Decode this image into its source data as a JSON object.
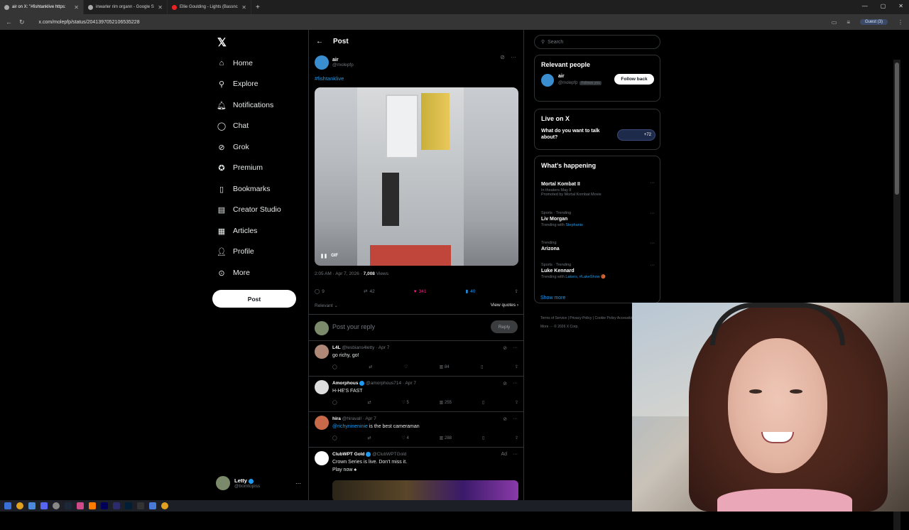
{
  "browser": {
    "tabs": [
      {
        "label": "air on X: \"#fishtanklive https:"
      },
      {
        "label": "inwarler rim organn - Google S"
      },
      {
        "label": "Ellie Goulding - Lights (Bassnc"
      }
    ],
    "url": "x.com/molepfp/status/2041397052106535228",
    "guest_label": "Guest (3)"
  },
  "nav": {
    "items": [
      {
        "label": "Home",
        "icon": "home-icon"
      },
      {
        "label": "Explore",
        "icon": "search-icon"
      },
      {
        "label": "Notifications",
        "icon": "bell-icon"
      },
      {
        "label": "Chat",
        "icon": "chat-icon"
      },
      {
        "label": "Grok",
        "icon": "grok-icon"
      },
      {
        "label": "Premium",
        "icon": "premium-icon"
      },
      {
        "label": "Bookmarks",
        "icon": "bookmark-icon"
      },
      {
        "label": "Creator Studio",
        "icon": "creator-icon"
      },
      {
        "label": "Articles",
        "icon": "articles-icon"
      },
      {
        "label": "Profile",
        "icon": "profile-icon"
      },
      {
        "label": "More",
        "icon": "more-icon"
      }
    ],
    "post_label": "Post",
    "account": {
      "name": "Letty",
      "handle": "@bomtopiss"
    }
  },
  "post": {
    "header_title": "Post",
    "author_name": "air",
    "author_handle": "@molepfp",
    "hashtag": "#fishtanklive",
    "gif_label": "GIF",
    "time": "2:05 AM · Apr 7, 2026 · ",
    "views_count": "7,008",
    "views_label": " Views",
    "replies": "9",
    "reposts": "42",
    "likes": "341",
    "bookmarks": "40",
    "sort_label": "Relevant ⌄",
    "view_quotes": "View quotes ›",
    "reply_placeholder": "Post your reply",
    "reply_button": "Reply"
  },
  "replies": [
    {
      "name": "L4L",
      "handle": "@lesbians4letty · Apr 7",
      "text": "go richy, go!",
      "mention": "",
      "likes": "",
      "views": "84"
    },
    {
      "name": "Amorphous",
      "handle": "@amorphous714 · Apr 7",
      "text": "H-HE'S FAST",
      "mention": "",
      "likes": "5",
      "views": "255"
    },
    {
      "name": "hira",
      "handle": "@hiravall · Apr 7",
      "text": " is the best cameraman",
      "mention": "@richynineninie",
      "likes": "4",
      "views": "288"
    },
    {
      "name": "ClubWPT Gold",
      "handle": "@ClubWPTGold",
      "text": "Crown Series is live. Don't miss it.",
      "text2": "Play now ♠",
      "ad_label": "Ad"
    }
  ],
  "sidebar": {
    "search_placeholder": "Search",
    "relevant_title": "Relevant people",
    "relevant_name": "air",
    "relevant_handle": "@molepfp",
    "follows_you": "Follows you",
    "follow_back": "Follow back",
    "live_title": "Live on X",
    "live_question": "What do you want to talk about?",
    "live_count": "+72",
    "happening_title": "What's happening",
    "trends": [
      {
        "meta": "",
        "title": "Mortal Kombat II",
        "sub": "In theaters May 8",
        "sub2": "Promoted by Mortal Kombat Movie",
        "link": ""
      },
      {
        "meta": "Sports · Trending",
        "title": "Liv Morgan",
        "sub": "Trending with ",
        "link": "Stephanie"
      },
      {
        "meta": "Trending",
        "title": "Arizona",
        "sub": "",
        "link": ""
      },
      {
        "meta": "Sports · Trending",
        "title": "Luke Kennard",
        "sub": "Trending with ",
        "link": "Lakers, #LakeShow 🏀"
      }
    ],
    "show_more": "Show more",
    "footer": "Terms of Service  |  Privacy Policy  |  Cookie Policy  Accessibility  |  Ads info  |  More ···  © 2026 X Corp."
  }
}
